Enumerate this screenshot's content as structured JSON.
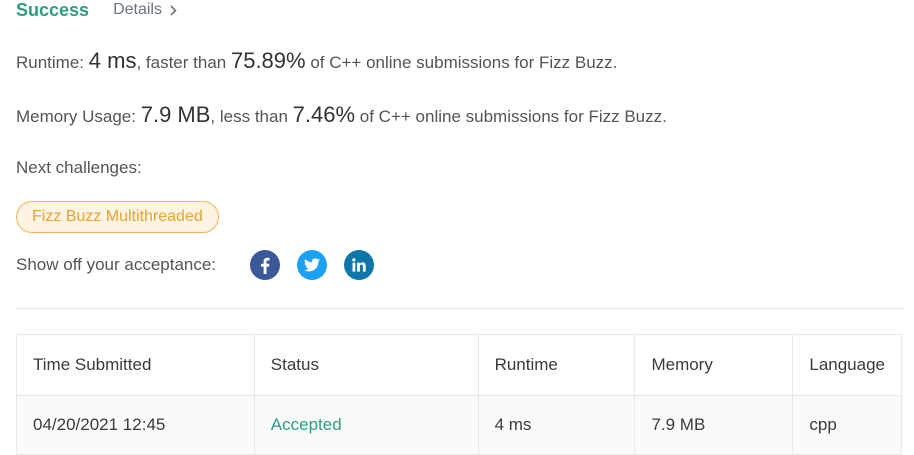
{
  "header": {
    "status": "Success",
    "details_label": "Details"
  },
  "runtime": {
    "label": "Runtime:",
    "value": "4 ms",
    "mid_text": ", faster than",
    "percent": "75.89%",
    "suffix": "of C++ online submissions for Fizz Buzz."
  },
  "memory": {
    "label": "Memory Usage:",
    "value": "7.9 MB",
    "mid_text": ", less than",
    "percent": "7.46%",
    "suffix": "of C++ online submissions for Fizz Buzz."
  },
  "next_challenges": {
    "label": "Next challenges:",
    "items": [
      "Fizz Buzz Multithreaded"
    ]
  },
  "share": {
    "label": "Show off your acceptance:",
    "icons": [
      "facebook-icon",
      "twitter-icon",
      "linkedin-icon"
    ]
  },
  "submissions": {
    "columns": [
      "Time Submitted",
      "Status",
      "Runtime",
      "Memory",
      "Language"
    ],
    "rows": [
      [
        "04/20/2021 12:45",
        "Accepted",
        "4 ms",
        "7.9 MB",
        "cpp"
      ]
    ]
  },
  "colors": {
    "success": "#2e9c80",
    "tag_text": "#e8a135",
    "tag_border": "#f3b35b",
    "tag_bg": "#fff4e1",
    "facebook": "#3b5998",
    "twitter": "#1da1f2",
    "linkedin": "#0e76a8"
  }
}
